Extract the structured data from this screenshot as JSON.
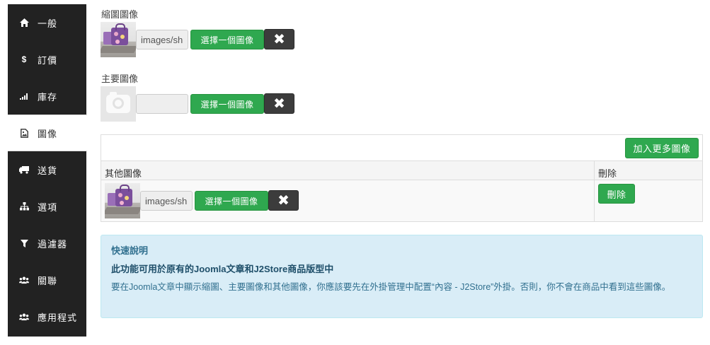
{
  "sidebar": {
    "items": [
      {
        "label": "一般",
        "icon": "home-icon"
      },
      {
        "label": "訂價",
        "icon": "dollar-icon"
      },
      {
        "label": "庫存",
        "icon": "signal-icon"
      },
      {
        "label": "圖像",
        "icon": "file-image-icon"
      },
      {
        "label": "送貨",
        "icon": "truck-icon"
      },
      {
        "label": "選項",
        "icon": "sitemap-icon"
      },
      {
        "label": "過濾器",
        "icon": "filter-icon"
      },
      {
        "label": "關聯",
        "icon": "users-icon"
      },
      {
        "label": "應用程式",
        "icon": "users-icon"
      }
    ],
    "active_index": 3
  },
  "thumbnail_image": {
    "label": "縮圖圖像",
    "path_value": "images/sh",
    "select_label": "選擇一個圖像",
    "clear_symbol": "✖"
  },
  "main_image": {
    "label": "主要圖像",
    "path_value": "",
    "select_label": "選擇一個圖像",
    "clear_symbol": "✖"
  },
  "additional_images": {
    "add_more_label": "加入更多圖像",
    "columns": [
      "其他圖像",
      "刪除"
    ],
    "rows": [
      {
        "path_value": "images/sh",
        "select_label": "選擇一個圖像",
        "clear_symbol": "✖",
        "delete_label": "刪除"
      }
    ]
  },
  "help": {
    "title": "快速說明",
    "bold_line": "此功能可用於原有的Joomla文章和J2Store商品版型中",
    "body": "要在Joomla文章中顯示縮圖、主要圖像和其他圖像，你應該要先在外掛管理中配置“內容 - J2Store”外掛。否則，你不會在商品中看到這些圖像。"
  }
}
